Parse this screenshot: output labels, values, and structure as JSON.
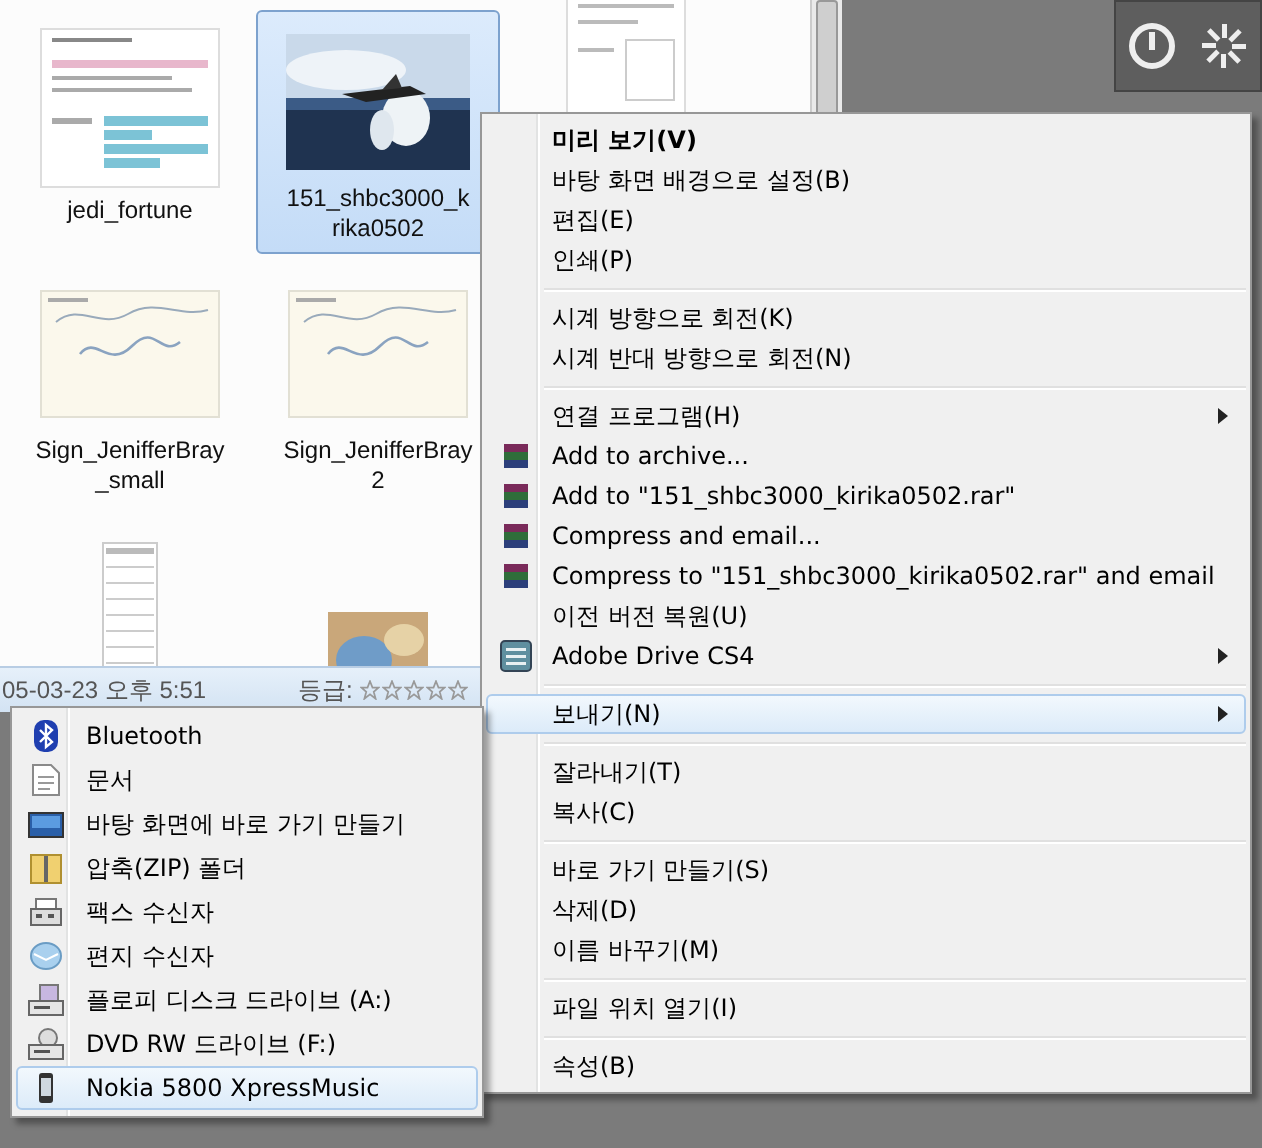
{
  "explorer": {
    "items": [
      {
        "lines": [
          "jedi_fortune"
        ],
        "kind": "document",
        "selected": false
      },
      {
        "lines": [
          "151_shbc3000_k",
          "rika0502"
        ],
        "selected": true
      },
      {
        "kind": "form",
        "selected": false
      },
      {
        "lines": [
          "Sign_JenifferBray",
          "_small"
        ],
        "kind": "signature",
        "selected": false
      },
      {
        "lines": [
          "Sign_JenifferBray",
          "2"
        ],
        "kind": "signature",
        "selected": false
      },
      {
        "kind": "none"
      },
      {
        "kind": "sheet",
        "selected": false
      },
      {
        "kind": "photo2",
        "selected": false
      }
    ]
  },
  "status_bar": {
    "date": "05-03-23 오후 5:51",
    "rating_label": "등급:",
    "stars": 0
  },
  "context_menu": [
    {
      "kind": "plain",
      "label": "미리 보기(V)",
      "bold": true,
      "submenu": false,
      "selected": false
    },
    {
      "kind": "plain",
      "label": "바탕 화면 배경으로 설정(B)",
      "bold": false,
      "submenu": false,
      "selected": false
    },
    {
      "kind": "plain",
      "label": "편집(E)",
      "bold": false,
      "submenu": false,
      "selected": false
    },
    {
      "kind": "plain",
      "label": "인쇄(P)",
      "bold": false,
      "submenu": false,
      "selected": false
    },
    {
      "kind": "separator"
    },
    {
      "kind": "plain",
      "label": "시계 방향으로 회전(K)",
      "bold": false,
      "submenu": false,
      "selected": false
    },
    {
      "kind": "plain",
      "label": "시계 반대 방향으로 회전(N)",
      "bold": false,
      "submenu": false,
      "selected": false
    },
    {
      "kind": "separator"
    },
    {
      "kind": "plain",
      "label": "연결 프로그램(H)",
      "bold": false,
      "submenu": true,
      "selected": false
    },
    {
      "kind": "archive",
      "label": "Add to archive...",
      "bold": false,
      "submenu": false,
      "selected": false
    },
    {
      "kind": "archive",
      "label": "Add to \"151_shbc3000_kirika0502.rar\"",
      "bold": false,
      "submenu": false,
      "selected": false
    },
    {
      "kind": "archive",
      "label": "Compress and email...",
      "bold": false,
      "submenu": false,
      "selected": false
    },
    {
      "kind": "archive",
      "label": "Compress to \"151_shbc3000_kirika0502.rar\" and email",
      "bold": false,
      "submenu": false,
      "selected": false
    },
    {
      "kind": "plain",
      "label": "이전 버전 복원(U)",
      "bold": false,
      "submenu": false,
      "selected": false
    },
    {
      "kind": "list",
      "label": "Adobe Drive CS4",
      "bold": false,
      "submenu": true,
      "selected": false
    },
    {
      "kind": "separator"
    },
    {
      "kind": "plain",
      "label": "보내기(N)",
      "bold": false,
      "submenu": true,
      "selected": true
    },
    {
      "kind": "separator"
    },
    {
      "kind": "plain",
      "label": "잘라내기(T)",
      "bold": false,
      "submenu": false,
      "selected": false
    },
    {
      "kind": "plain",
      "label": "복사(C)",
      "bold": false,
      "submenu": false,
      "selected": false
    },
    {
      "kind": "separator"
    },
    {
      "kind": "plain",
      "label": "바로 가기 만들기(S)",
      "bold": false,
      "submenu": false,
      "selected": false
    },
    {
      "kind": "plain",
      "label": "삭제(D)",
      "bold": false,
      "submenu": false,
      "selected": false
    },
    {
      "kind": "plain",
      "label": "이름 바꾸기(M)",
      "bold": false,
      "submenu": false,
      "selected": false
    },
    {
      "kind": "separator"
    },
    {
      "kind": "plain",
      "label": "파일 위치 열기(I)",
      "bold": false,
      "submenu": false,
      "selected": false
    },
    {
      "kind": "separator"
    },
    {
      "kind": "plain",
      "label": "속성(B)",
      "bold": false,
      "submenu": false,
      "selected": false
    }
  ],
  "send_to_menu": [
    {
      "kind": "bluetooth",
      "label": "Bluetooth",
      "selected": false
    },
    {
      "kind": "document",
      "label": "문서",
      "selected": false
    },
    {
      "kind": "desktop",
      "label": "바탕 화면에 바로 가기 만들기",
      "selected": false
    },
    {
      "kind": "zip",
      "label": "압축(ZIP) 폴더",
      "selected": false
    },
    {
      "kind": "fax",
      "label": "팩스 수신자",
      "selected": false
    },
    {
      "kind": "mail",
      "label": "편지 수신자",
      "selected": false
    },
    {
      "kind": "floppy",
      "label": "플로피 디스크 드라이브 (A:)",
      "selected": false
    },
    {
      "kind": "dvd",
      "label": "DVD RW 드라이브 (F:)",
      "selected": false
    },
    {
      "kind": "phone",
      "label": "Nokia 5800 XpressMusic",
      "selected": true
    }
  ]
}
